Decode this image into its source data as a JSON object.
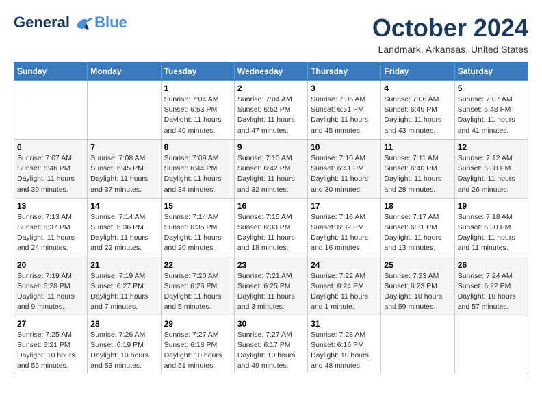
{
  "header": {
    "logo_line1": "General",
    "logo_line2": "Blue",
    "month": "October 2024",
    "location": "Landmark, Arkansas, United States"
  },
  "weekdays": [
    "Sunday",
    "Monday",
    "Tuesday",
    "Wednesday",
    "Thursday",
    "Friday",
    "Saturday"
  ],
  "weeks": [
    [
      {
        "day": "",
        "info": ""
      },
      {
        "day": "",
        "info": ""
      },
      {
        "day": "1",
        "info": "Sunrise: 7:04 AM\nSunset: 6:53 PM\nDaylight: 11 hours and 49 minutes."
      },
      {
        "day": "2",
        "info": "Sunrise: 7:04 AM\nSunset: 6:52 PM\nDaylight: 11 hours and 47 minutes."
      },
      {
        "day": "3",
        "info": "Sunrise: 7:05 AM\nSunset: 6:51 PM\nDaylight: 11 hours and 45 minutes."
      },
      {
        "day": "4",
        "info": "Sunrise: 7:06 AM\nSunset: 6:49 PM\nDaylight: 11 hours and 43 minutes."
      },
      {
        "day": "5",
        "info": "Sunrise: 7:07 AM\nSunset: 6:48 PM\nDaylight: 11 hours and 41 minutes."
      }
    ],
    [
      {
        "day": "6",
        "info": "Sunrise: 7:07 AM\nSunset: 6:46 PM\nDaylight: 11 hours and 39 minutes."
      },
      {
        "day": "7",
        "info": "Sunrise: 7:08 AM\nSunset: 6:45 PM\nDaylight: 11 hours and 37 minutes."
      },
      {
        "day": "8",
        "info": "Sunrise: 7:09 AM\nSunset: 6:44 PM\nDaylight: 11 hours and 34 minutes."
      },
      {
        "day": "9",
        "info": "Sunrise: 7:10 AM\nSunset: 6:42 PM\nDaylight: 11 hours and 32 minutes."
      },
      {
        "day": "10",
        "info": "Sunrise: 7:10 AM\nSunset: 6:41 PM\nDaylight: 11 hours and 30 minutes."
      },
      {
        "day": "11",
        "info": "Sunrise: 7:11 AM\nSunset: 6:40 PM\nDaylight: 11 hours and 28 minutes."
      },
      {
        "day": "12",
        "info": "Sunrise: 7:12 AM\nSunset: 6:38 PM\nDaylight: 11 hours and 26 minutes."
      }
    ],
    [
      {
        "day": "13",
        "info": "Sunrise: 7:13 AM\nSunset: 6:37 PM\nDaylight: 11 hours and 24 minutes."
      },
      {
        "day": "14",
        "info": "Sunrise: 7:14 AM\nSunset: 6:36 PM\nDaylight: 11 hours and 22 minutes."
      },
      {
        "day": "15",
        "info": "Sunrise: 7:14 AM\nSunset: 6:35 PM\nDaylight: 11 hours and 20 minutes."
      },
      {
        "day": "16",
        "info": "Sunrise: 7:15 AM\nSunset: 6:33 PM\nDaylight: 11 hours and 18 minutes."
      },
      {
        "day": "17",
        "info": "Sunrise: 7:16 AM\nSunset: 6:32 PM\nDaylight: 11 hours and 16 minutes."
      },
      {
        "day": "18",
        "info": "Sunrise: 7:17 AM\nSunset: 6:31 PM\nDaylight: 11 hours and 13 minutes."
      },
      {
        "day": "19",
        "info": "Sunrise: 7:18 AM\nSunset: 6:30 PM\nDaylight: 11 hours and 11 minutes."
      }
    ],
    [
      {
        "day": "20",
        "info": "Sunrise: 7:19 AM\nSunset: 6:28 PM\nDaylight: 11 hours and 9 minutes."
      },
      {
        "day": "21",
        "info": "Sunrise: 7:19 AM\nSunset: 6:27 PM\nDaylight: 11 hours and 7 minutes."
      },
      {
        "day": "22",
        "info": "Sunrise: 7:20 AM\nSunset: 6:26 PM\nDaylight: 11 hours and 5 minutes."
      },
      {
        "day": "23",
        "info": "Sunrise: 7:21 AM\nSunset: 6:25 PM\nDaylight: 11 hours and 3 minutes."
      },
      {
        "day": "24",
        "info": "Sunrise: 7:22 AM\nSunset: 6:24 PM\nDaylight: 11 hours and 1 minute."
      },
      {
        "day": "25",
        "info": "Sunrise: 7:23 AM\nSunset: 6:23 PM\nDaylight: 10 hours and 59 minutes."
      },
      {
        "day": "26",
        "info": "Sunrise: 7:24 AM\nSunset: 6:22 PM\nDaylight: 10 hours and 57 minutes."
      }
    ],
    [
      {
        "day": "27",
        "info": "Sunrise: 7:25 AM\nSunset: 6:21 PM\nDaylight: 10 hours and 55 minutes."
      },
      {
        "day": "28",
        "info": "Sunrise: 7:26 AM\nSunset: 6:19 PM\nDaylight: 10 hours and 53 minutes."
      },
      {
        "day": "29",
        "info": "Sunrise: 7:27 AM\nSunset: 6:18 PM\nDaylight: 10 hours and 51 minutes."
      },
      {
        "day": "30",
        "info": "Sunrise: 7:27 AM\nSunset: 6:17 PM\nDaylight: 10 hours and 49 minutes."
      },
      {
        "day": "31",
        "info": "Sunrise: 7:28 AM\nSunset: 6:16 PM\nDaylight: 10 hours and 48 minutes."
      },
      {
        "day": "",
        "info": ""
      },
      {
        "day": "",
        "info": ""
      }
    ]
  ]
}
